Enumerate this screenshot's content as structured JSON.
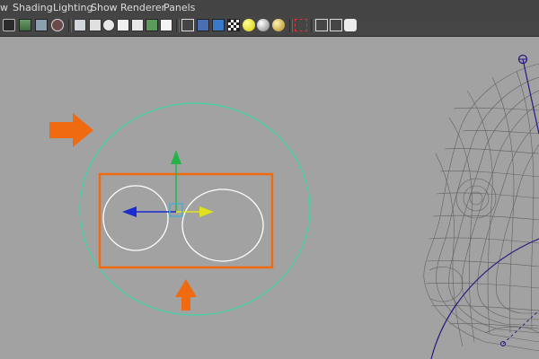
{
  "menu": {
    "items": [
      "w",
      "Shading",
      "Lighting",
      "Show",
      "Renderer",
      "Panels"
    ]
  },
  "toolbar": {
    "icons": [
      "camera-icon",
      "bookmark-icon",
      "image-plane-icon",
      "grid-toggle-icon",
      "wireframe-icon",
      "smooth-shade-icon",
      "bounding-box-icon",
      "shade-all-icon",
      "xray-icon",
      "textured-icon",
      "default-lighting-icon",
      "cube-icon",
      "blue-cube-icon",
      "checker-icon",
      "yellow-sphere-icon",
      "grey-sphere-icon",
      "gold-sphere-icon",
      "select-camera-icon",
      "isolate-select-icon",
      "single-perspective-icon",
      "share-icon"
    ]
  },
  "colors": {
    "viewport_bg": "#a2a2a2",
    "menubar_bg": "#444444",
    "curve_teal": "#3cd6a8",
    "curve_white": "#ffffff",
    "highlight_orange": "#f06a10",
    "manip_x": "#e2e21c",
    "manip_y": "#26b44a",
    "manip_z": "#1a2bd0",
    "wireframe": "#5a5a5a",
    "curve_purple": "#2a1a80"
  },
  "annotations": {
    "arrow_right": "orange-arrow-right",
    "arrow_up": "orange-arrow-up",
    "highlight": "orange-rectangle"
  }
}
